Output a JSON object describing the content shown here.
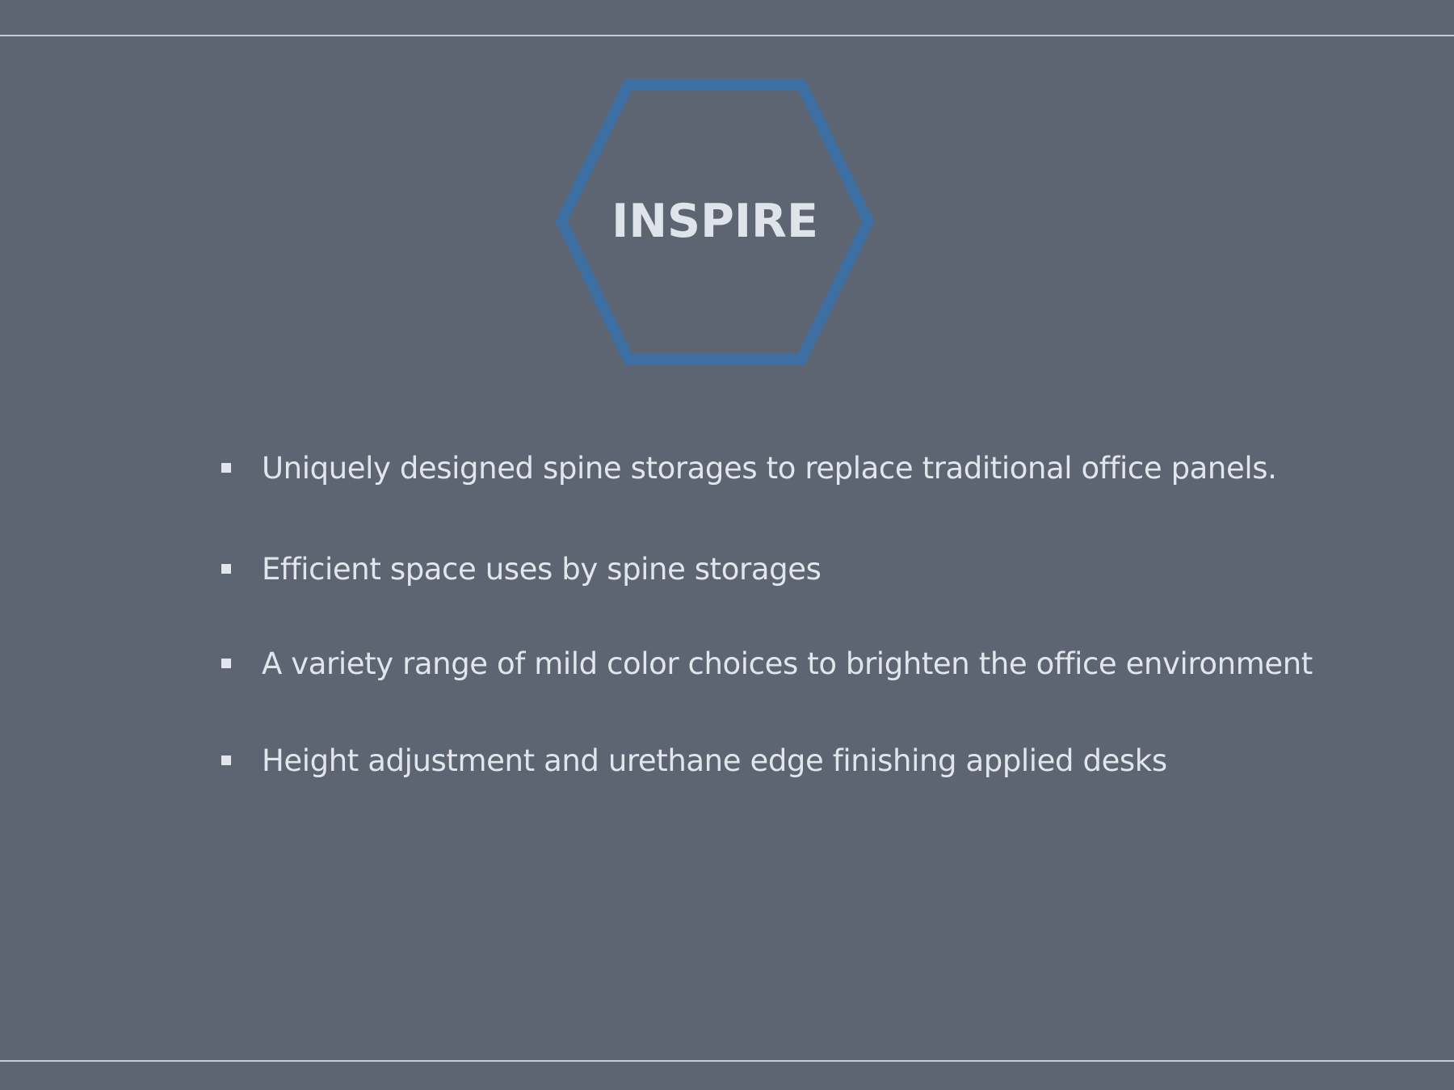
{
  "slide": {
    "title": "INSPIRE",
    "bullets": [
      {
        "text": "Uniquely designed spine storages to replace traditional office panels."
      },
      {
        "text": "Efficient space uses by spine storages"
      },
      {
        "text": "A variety range of mild color choices to brighten the office environment"
      },
      {
        "text": "Height adjustment and urethane edge finishing applied desks"
      }
    ]
  },
  "colors": {
    "background": "#5c6571",
    "hexagon_stroke": "#3e6fa3",
    "text": "#e2e6ec",
    "rule": "#c9ced5"
  },
  "icons": {
    "bullet": "square-bullet-icon",
    "badge": "hexagon-outline-icon"
  }
}
